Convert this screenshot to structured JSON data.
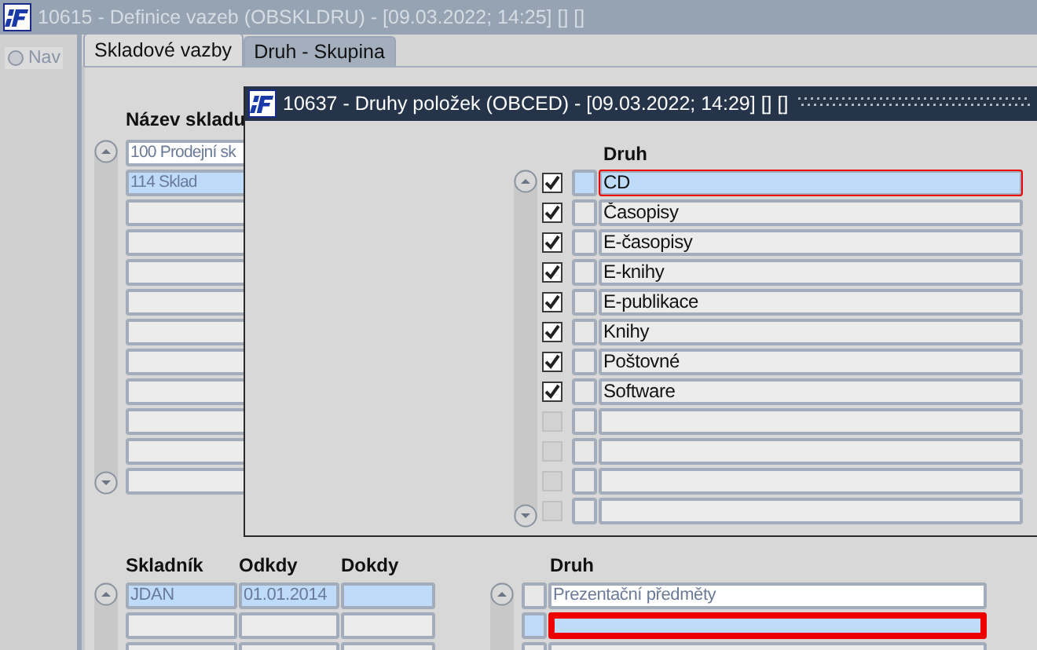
{
  "window": {
    "title": "10615 - Definice vazeb (OBSKLDRU) - [09.03.2022; 14:25] [] []"
  },
  "nav": {
    "label": "Nav",
    "selected": false
  },
  "tabs": [
    {
      "label": "Skladové vazby",
      "selected": true
    },
    {
      "label": "Druh - Skupina",
      "selected": false
    }
  ],
  "warehouses": {
    "column": "Název skladu",
    "rows": [
      {
        "name": "100 Prodejní sk",
        "selected": false
      },
      {
        "name": "114 Sklad",
        "selected": true
      },
      {
        "selected": false
      },
      {
        "selected": false
      },
      {
        "selected": false
      },
      {
        "selected": false
      },
      {
        "selected": false
      },
      {
        "selected": false
      },
      {
        "selected": false
      },
      {
        "selected": false
      },
      {
        "selected": false
      },
      {
        "selected": false
      }
    ]
  },
  "storekeepers": {
    "columns": [
      "Skladník",
      "Odkdy",
      "Dokdy"
    ],
    "rows": [
      {
        "cells": [
          "JDAN",
          "01.01.2014"
        ],
        "selected": true
      },
      {
        "selected": false
      },
      {
        "selected": false
      }
    ]
  },
  "types": {
    "column": "Druh",
    "rows": [
      {
        "name": "Prezentační předměty",
        "selected": false,
        "focused": false
      },
      {
        "selected": true,
        "focused": true
      },
      {
        "selected": false,
        "focused": false
      }
    ]
  },
  "popup": {
    "title": "10637 - Druhy položek (OBCED) - [09.03.2022; 14:29] [] []",
    "column": "Druh",
    "rows": [
      {
        "name": "CD",
        "checked": true,
        "selected": true
      },
      {
        "name": "Časopisy",
        "checked": true,
        "selected": false
      },
      {
        "name": "E-časopisy",
        "checked": true,
        "selected": false
      },
      {
        "name": "E-knihy",
        "checked": true,
        "selected": false
      },
      {
        "name": "E-publikace",
        "checked": true,
        "selected": false
      },
      {
        "name": "Knihy",
        "checked": true,
        "selected": false
      },
      {
        "name": "Poštovné",
        "checked": true,
        "selected": false
      },
      {
        "name": "Software",
        "checked": true,
        "selected": false
      },
      {
        "checked": false,
        "selected": false
      },
      {
        "checked": false,
        "selected": false
      },
      {
        "checked": false,
        "selected": false
      },
      {
        "checked": false,
        "selected": false
      }
    ]
  }
}
